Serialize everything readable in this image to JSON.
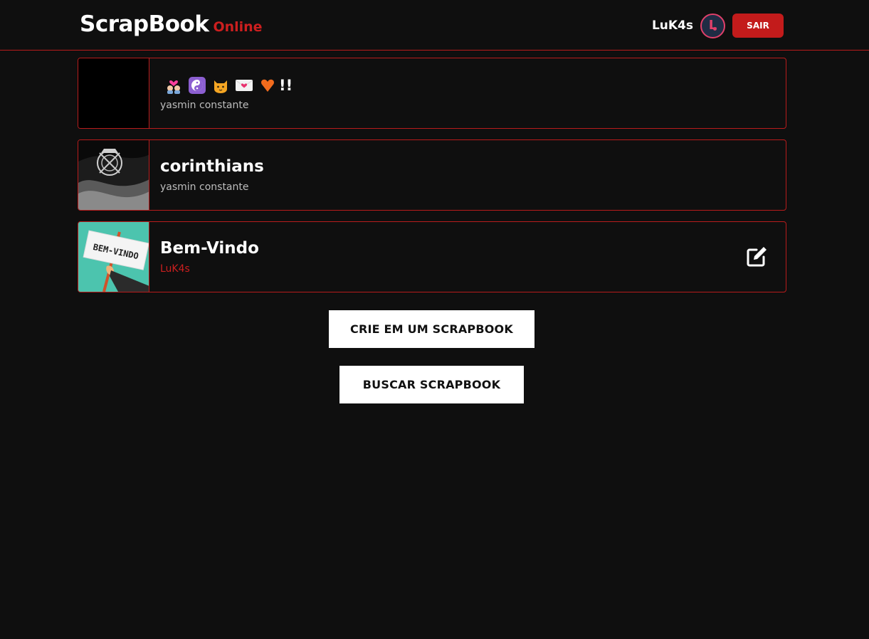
{
  "header": {
    "brand_main": "ScrapBook",
    "brand_sub": "Online",
    "username": "LuK4s",
    "avatar_initial": "L",
    "logout_label": "SAIR"
  },
  "scrapbooks": [
    {
      "title_suffix": "!!",
      "title_emoji_icons": [
        "kiss-couple-icon",
        "yin-yang-icon",
        "cat-icon",
        "love-letter-icon",
        "orange-heart-icon"
      ],
      "author": "yasmin constante",
      "thumbnail": "black-thumbnail"
    },
    {
      "title": "corinthians",
      "author": "yasmin constante",
      "thumbnail": "corinthians-flag-thumbnail"
    },
    {
      "title": "Bem-Vindo",
      "author": "LuK4s",
      "thumbnail": "bem-vindo-sign-thumbnail",
      "thumbnail_text": "BEM-VINDO",
      "editable": true
    }
  ],
  "actions": {
    "create_label": "CRIE EM UM SCRAPBOOK",
    "search_label": "BUSCAR SCRAPBOOK"
  },
  "colors": {
    "background": "#0f0f0f",
    "accent": "#c31b1b",
    "border": "#b81c1c",
    "muted_text": "#bdbdbd"
  }
}
